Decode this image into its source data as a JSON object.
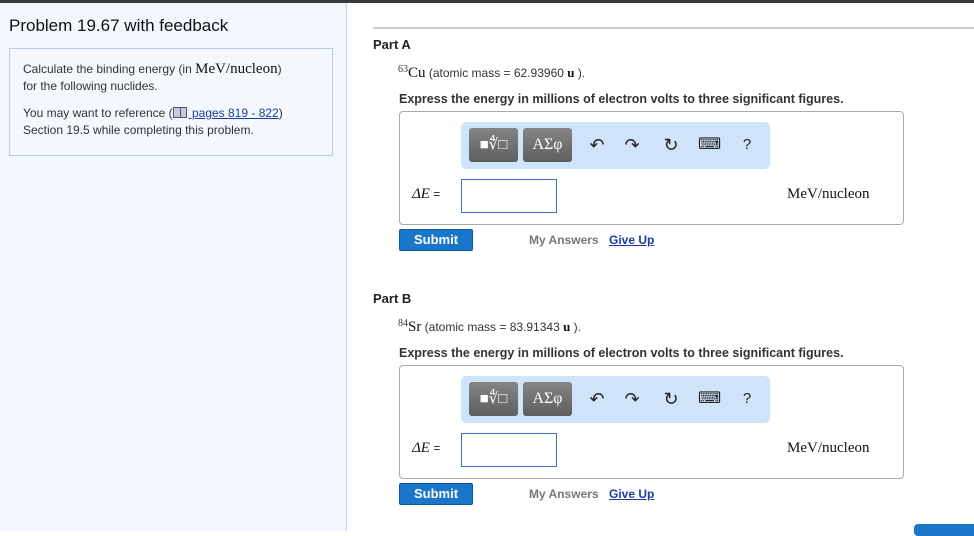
{
  "problem_title": "Problem 19.67 with feedback",
  "intro": {
    "text1": "Calculate the binding energy (in ",
    "unit": "MeV/nucleon",
    "text1_end": ")",
    "text2": "for the following nuclides.",
    "ref_prefix": "You may want to reference (",
    "ref_link": " pages 819 - 822",
    "ref_suffix": ")",
    "ref_line2": "Section 19.5 while completing this problem."
  },
  "parts": [
    {
      "label": "Part A",
      "mass_number": "63",
      "element": "Cu",
      "mass_text": " (atomic mass = 62.93960 ",
      "mass_unit": "u",
      "mass_end": " ).",
      "instruction": "Express the energy in millions of electron volts to three significant figures.",
      "variable": "ΔE",
      "equals": " =",
      "value": "",
      "units": "MeV/nucleon",
      "submit": "Submit",
      "my_answers": "My Answers",
      "give_up": "Give Up"
    },
    {
      "label": "Part B",
      "mass_number": "84",
      "element": "Sr",
      "mass_text": " (atomic mass = 83.91343 ",
      "mass_unit": "u",
      "mass_end": " ).",
      "instruction": "Express the energy in millions of electron volts to three significant figures.",
      "variable": "ΔE",
      "equals": " =",
      "value": "",
      "units": "MeV/nucleon",
      "submit": "Submit",
      "my_answers": "My Answers",
      "give_up": "Give Up"
    }
  ],
  "toolbar": {
    "templates": "■∜□",
    "symbols": "ΑΣφ",
    "undo": "↶",
    "redo": "↷",
    "reset": "↻",
    "keyboard": "⌨",
    "help": "?"
  }
}
